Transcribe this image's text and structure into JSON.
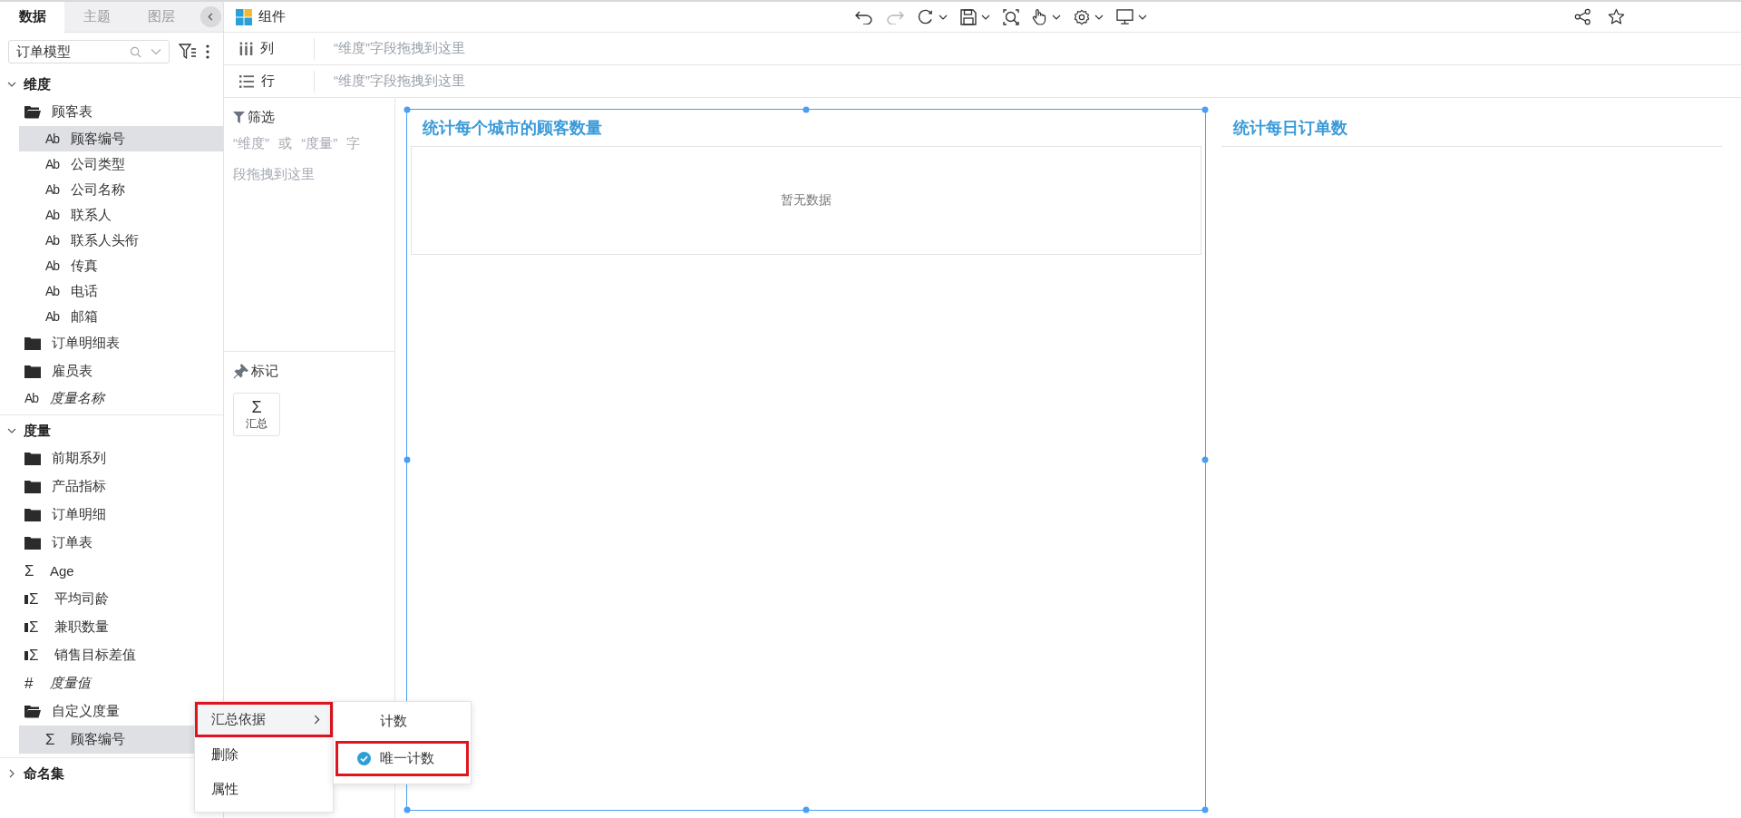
{
  "panel_tabs": [
    {
      "label": "数据",
      "selected": true
    },
    {
      "label": "主题",
      "selected": false
    },
    {
      "label": "图层",
      "selected": false
    }
  ],
  "model_select": {
    "value": "订单模型"
  },
  "tree": [
    {
      "label": "维度",
      "expanded": true,
      "children": [
        {
          "kind": "folder",
          "label": "顾客表",
          "expanded": true,
          "children": [
            {
              "kind": "field",
              "icon": "Ab",
              "label": "顾客编号",
              "selected": true
            },
            {
              "kind": "field",
              "icon": "Ab",
              "label": "公司类型",
              "selected": false
            },
            {
              "kind": "field",
              "icon": "Ab",
              "label": "公司名称",
              "selected": false
            },
            {
              "kind": "field",
              "icon": "Ab",
              "label": "联系人",
              "selected": false
            },
            {
              "kind": "field",
              "icon": "Ab",
              "label": "联系人头衔",
              "selected": false
            },
            {
              "kind": "field",
              "icon": "Ab",
              "label": "传真",
              "selected": false
            },
            {
              "kind": "field",
              "icon": "Ab",
              "label": "电话",
              "selected": false
            },
            {
              "kind": "field",
              "icon": "Ab",
              "label": "邮箱",
              "selected": false
            }
          ]
        },
        {
          "kind": "folder",
          "label": "订单明细表",
          "expanded": false
        },
        {
          "kind": "folder",
          "label": "雇员表",
          "expanded": false
        },
        {
          "kind": "virtual",
          "icon": "Ab",
          "label": "度量名称",
          "selected": false
        }
      ]
    },
    {
      "label": "度量",
      "expanded": true,
      "children": [
        {
          "kind": "folder",
          "label": "前期系列",
          "expanded": false
        },
        {
          "kind": "folder",
          "label": "产品指标",
          "expanded": false
        },
        {
          "kind": "folder",
          "label": "订单明细",
          "expanded": false
        },
        {
          "kind": "folder",
          "label": "订单表",
          "expanded": false
        },
        {
          "kind": "field",
          "icon": "Σ",
          "label": "Age",
          "selected": false
        },
        {
          "kind": "calc_measure",
          "icon": "Σ",
          "label": "平均司龄",
          "selected": false
        },
        {
          "kind": "calc_measure",
          "icon": "Σ",
          "label": "兼职数量",
          "selected": false
        },
        {
          "kind": "calc_measure",
          "icon": "Σ",
          "label": "销售目标差值",
          "selected": false
        },
        {
          "kind": "virtual",
          "icon": "#",
          "label": "度量值",
          "selected": false
        },
        {
          "kind": "folder",
          "label": "自定义度量",
          "expanded": true,
          "children": [
            {
              "kind": "field",
              "icon": "Σ",
              "label": "顾客编号",
              "selected": true
            }
          ]
        }
      ]
    },
    {
      "label": "命名集",
      "expanded": false
    }
  ],
  "header": {
    "title": "组件"
  },
  "toolbar": [
    {
      "kind": "undo",
      "disabled": false,
      "dropdown": false
    },
    {
      "kind": "redo",
      "disabled": true,
      "dropdown": false
    },
    {
      "kind": "refresh",
      "disabled": false,
      "dropdown": true
    },
    {
      "kind": "save",
      "disabled": false,
      "dropdown": true
    },
    {
      "kind": "zoom",
      "disabled": false,
      "dropdown": false
    },
    {
      "kind": "hand",
      "disabled": false,
      "dropdown": true
    },
    {
      "kind": "gear",
      "disabled": false,
      "dropdown": true
    },
    {
      "kind": "monitor",
      "disabled": false,
      "dropdown": true
    }
  ],
  "toolbar_right": [
    {
      "kind": "share"
    },
    {
      "kind": "star"
    }
  ],
  "shelves": [
    {
      "kind": "columns",
      "label": "列",
      "hint": "“维度”字段拖拽到这里"
    },
    {
      "kind": "rows",
      "label": "行",
      "hint": "“维度”字段拖拽到这里"
    }
  ],
  "filter": {
    "label": "筛选",
    "hint": "“维度” 或 “度量” 字段拖拽到这里"
  },
  "marks": {
    "label": "标记",
    "cards": [
      {
        "icon": "Σ",
        "label": "汇总"
      }
    ]
  },
  "charts": [
    {
      "title": "统计每个城市的顾客数量",
      "selected": true,
      "empty_text": "暂无数据"
    },
    {
      "title": "统计每日订单数",
      "selected": false
    }
  ],
  "context_menu": {
    "items": [
      {
        "label": "汇总依据",
        "submenu": true,
        "highlighted": true,
        "selected": true
      },
      {
        "label": "删除",
        "submenu": false,
        "highlighted": false,
        "selected": false
      },
      {
        "label": "属性",
        "submenu": false,
        "highlighted": false,
        "selected": false
      }
    ],
    "submenu": [
      {
        "label": "计数",
        "selected": false,
        "highlighted": false
      },
      {
        "label": "唯一计数",
        "selected": true,
        "highlighted": true
      }
    ]
  }
}
